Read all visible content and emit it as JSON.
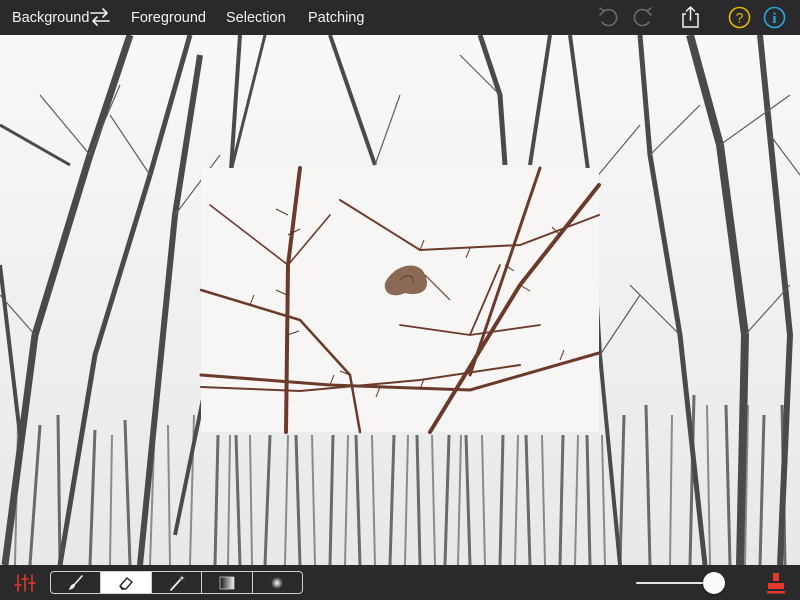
{
  "toolbar": {
    "tabs": [
      {
        "label": "Background"
      },
      {
        "label": "Foreground"
      },
      {
        "label": "Selection"
      },
      {
        "label": "Patching"
      }
    ],
    "icons": {
      "swap": "swap-arrows-icon",
      "undo": "undo-icon",
      "redo": "redo-icon",
      "share": "share-icon",
      "help": "help-icon",
      "info": "info-icon"
    },
    "colors": {
      "help": "#e6b800",
      "info": "#2aa8e0"
    }
  },
  "bottom_toolbar": {
    "tools": [
      "brush-icon",
      "eraser-icon",
      "magic-wand-icon",
      "gradient-icon",
      "soft-brush-icon"
    ],
    "active_tool": "eraser-icon",
    "opacity_level": 0.88,
    "colors": {
      "adjust": "#e0392b",
      "stamp": "#e0392b"
    }
  }
}
